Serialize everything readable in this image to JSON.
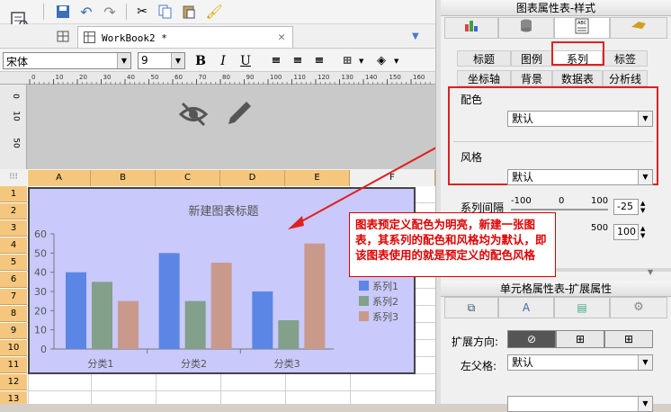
{
  "toolbar": {
    "icons": [
      "report-icon",
      "save-icon",
      "undo-icon",
      "redo-icon",
      "cut-icon",
      "copy-icon",
      "paste-icon",
      "brush-icon"
    ]
  },
  "tab": {
    "title": "WorkBook2 *"
  },
  "format": {
    "font": "宋体",
    "size": "9",
    "bold": "B",
    "italic": "I",
    "underline": "U"
  },
  "ruler": {
    "ticks": [
      "0",
      "10",
      "20",
      "30",
      "40",
      "50",
      "60",
      "70",
      "80",
      "90",
      "100",
      "110",
      "120",
      "130",
      "140",
      "150",
      "160"
    ],
    "vticks": [
      "0",
      "10",
      "50"
    ]
  },
  "sheet": {
    "columns": [
      "A",
      "B",
      "C",
      "D",
      "E",
      "F"
    ],
    "rows": [
      "1",
      "2",
      "3",
      "4",
      "5",
      "6",
      "7",
      "8",
      "9",
      "10",
      "11",
      "12",
      "13"
    ]
  },
  "chart_data": {
    "type": "bar",
    "title": "新建图表标题",
    "categories": [
      "分类1",
      "分类2",
      "分类3"
    ],
    "series": [
      {
        "name": "系列1",
        "values": [
          40,
          50,
          30
        ],
        "color": "#5b86e5"
      },
      {
        "name": "系列2",
        "values": [
          35,
          25,
          15
        ],
        "color": "#82a08a"
      },
      {
        "name": "系列3",
        "values": [
          25,
          45,
          55
        ],
        "color": "#c99a8c"
      }
    ],
    "ylim": [
      0,
      60
    ],
    "yticks": [
      "0",
      "10",
      "20",
      "30",
      "40",
      "50",
      "60"
    ],
    "legend": "right",
    "grid": false
  },
  "panel": {
    "header": "图表属性表-样式",
    "subtabs_row1": [
      "标题",
      "图例",
      "系列",
      "标签"
    ],
    "subtabs_row2": [
      "坐标轴",
      "背景",
      "数据表",
      "分析线"
    ],
    "color_label": "配色",
    "color_value": "默认",
    "style_label": "风格",
    "style_value": "默认",
    "gap_label": "系列间隔",
    "gap_scale": [
      "-100",
      "0",
      "100"
    ],
    "gap_value": "-25",
    "scale2": "500",
    "value2": "100",
    "header2": "单元格属性表-扩展属性",
    "expand_label": "扩展方向:",
    "leftparent_label": "左父格:",
    "leftparent_value": "默认"
  },
  "annotation": {
    "text": "图表预定义配色为明亮，新建一张图表，其系列的配色和风格均为默认，即该图表使用的就是预定义的配色风格"
  },
  "colors": {
    "accent_red": "#e02020",
    "header_orange": "#f5c77e",
    "chart_bg": "#c9c9fb"
  }
}
